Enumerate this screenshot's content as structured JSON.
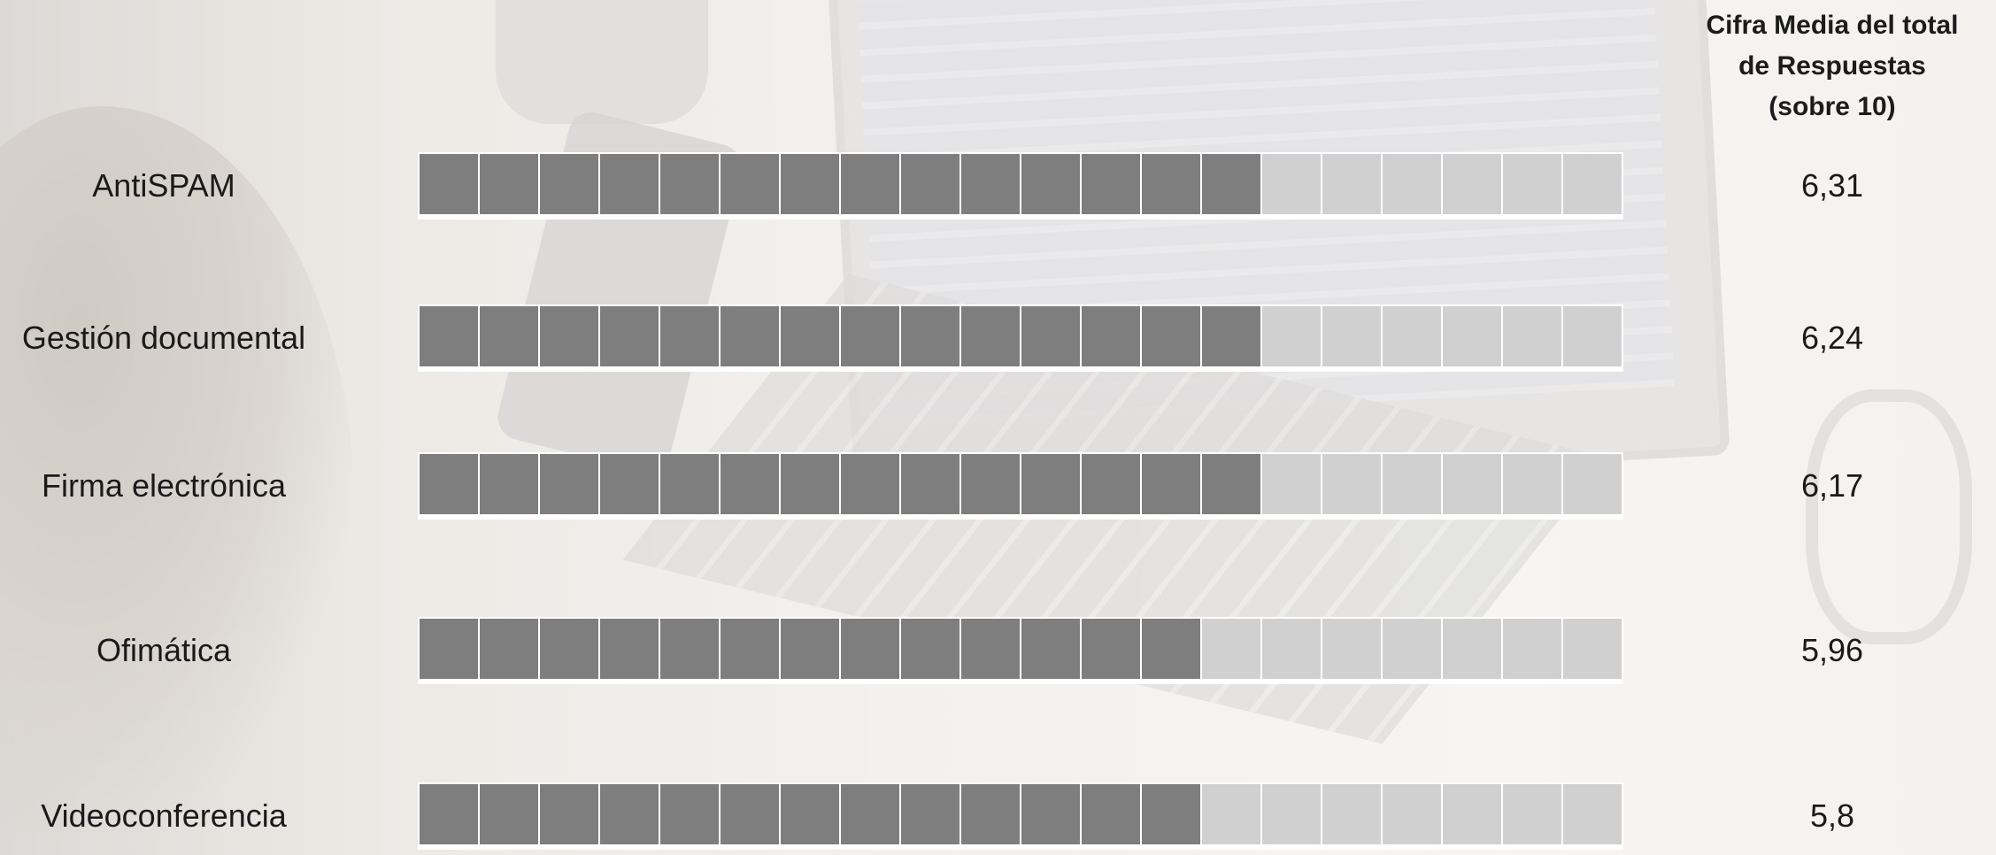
{
  "header": {
    "lines": [
      "Cifra Media del total",
      "de Respuestas",
      "(sobre 10)"
    ]
  },
  "chart_data": {
    "type": "bar",
    "title": "",
    "value_header": "Cifra Media del total de Respuestas (sobre 10)",
    "segments_total": 20,
    "scale_max": 10,
    "categories": [
      "AntiSPAM",
      "Gestión documental",
      "Firma electrónica",
      "Ofimática",
      "Videoconferencia"
    ],
    "values": [
      6.31,
      6.24,
      6.17,
      5.96,
      5.8
    ],
    "value_labels": [
      "6,31",
      "6,24",
      "6,17",
      "5,96",
      "5,8"
    ],
    "filled_segments": [
      14,
      14,
      14,
      13,
      13
    ],
    "colors": {
      "filled": "#7e7e7e",
      "empty": "#d1d0d0",
      "separator": "#ffffff"
    }
  }
}
